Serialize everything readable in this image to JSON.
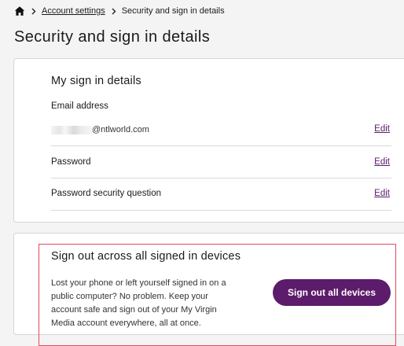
{
  "breadcrumb": {
    "home_icon": "home-icon",
    "items": [
      {
        "label": "Account settings",
        "link": true
      },
      {
        "label": "Security and sign in details",
        "link": false
      }
    ]
  },
  "page": {
    "title": "Security and sign in details"
  },
  "sign_in_details": {
    "heading": "My sign in details",
    "email": {
      "label": "Email address",
      "value_visible": "@ntlworld.com",
      "edit_label": "Edit"
    },
    "password": {
      "label": "Password",
      "edit_label": "Edit"
    },
    "security_question": {
      "label": "Password security question",
      "edit_label": "Edit"
    }
  },
  "sign_out": {
    "heading": "Sign out across all signed in devices",
    "description": "Lost your phone or left yourself signed in on a public computer? No problem. Keep your account safe and sign out of your My Virgin Media account everywhere, all at once.",
    "button_label": "Sign out all devices"
  },
  "colors": {
    "accent": "#5c1b6b",
    "highlight": "#e5485b",
    "background": "#f4f4f4"
  }
}
